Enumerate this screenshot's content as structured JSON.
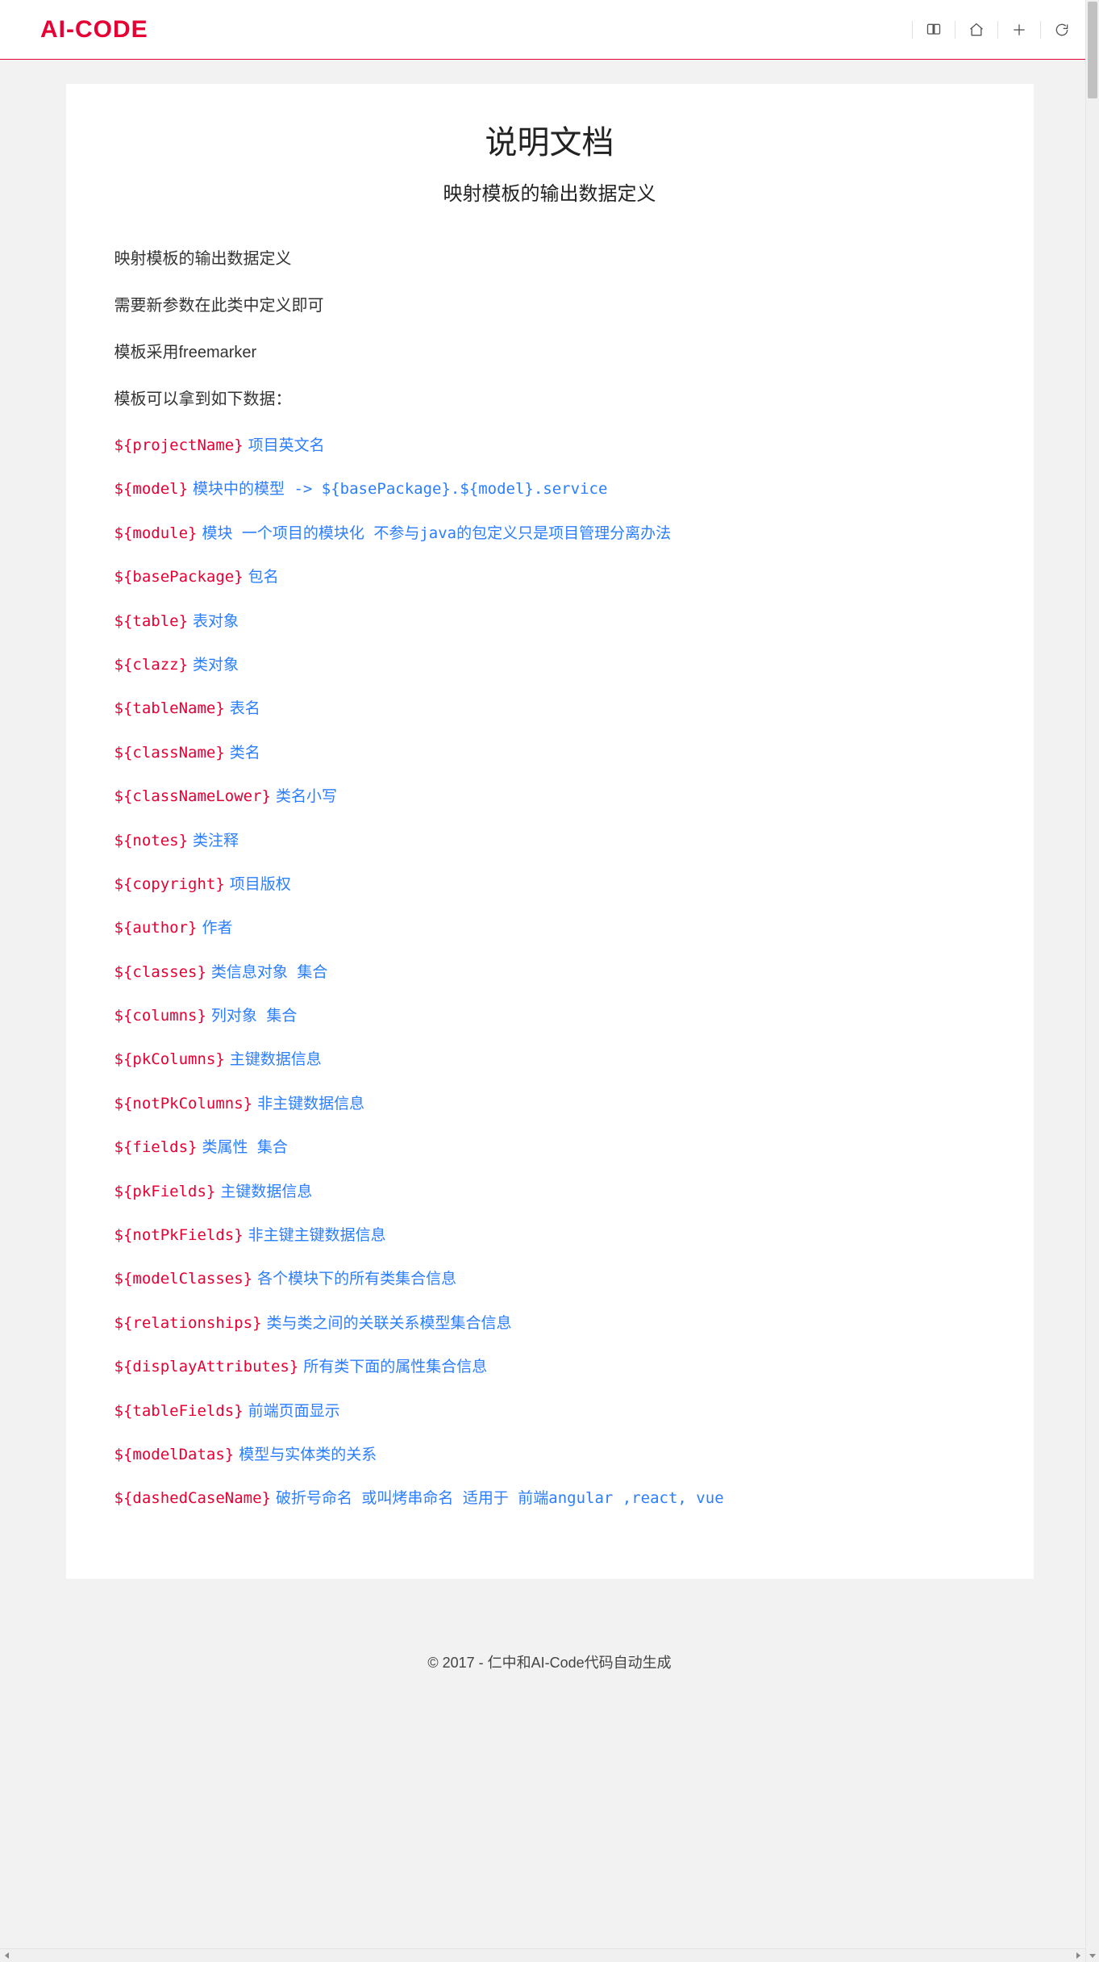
{
  "header": {
    "logo": "AI-CODE"
  },
  "doc": {
    "title": "说明文档",
    "subtitle": "映射模板的输出数据定义",
    "plainLines": [
      "映射模板的输出数据定义",
      "需要新参数在此类中定义即可",
      "模板采用freemarker",
      "模板可以拿到如下数据："
    ],
    "defs": [
      {
        "key": "${projectName}",
        "desc": "项目英文名"
      },
      {
        "key": "${model}",
        "desc": "模块中的模型 -> ${basePackage}.${model}.service"
      },
      {
        "key": "${module}",
        "desc": "模块  一个项目的模块化  不参与java的包定义只是项目管理分离办法"
      },
      {
        "key": "${basePackage}",
        "desc": "包名"
      },
      {
        "key": "${table}",
        "desc": "表对象"
      },
      {
        "key": "${clazz}",
        "desc": "类对象"
      },
      {
        "key": "${tableName}",
        "desc": "表名"
      },
      {
        "key": "${className}",
        "desc": "类名"
      },
      {
        "key": "${classNameLower}",
        "desc": "类名小写"
      },
      {
        "key": "${notes}",
        "desc": "类注释"
      },
      {
        "key": "${copyright}",
        "desc": "项目版权"
      },
      {
        "key": "${author}",
        "desc": "作者"
      },
      {
        "key": "${classes}",
        "desc": "类信息对象  集合"
      },
      {
        "key": "${columns}",
        "desc": "列对象  集合"
      },
      {
        "key": "${pkColumns}",
        "desc": "主键数据信息"
      },
      {
        "key": "${notPkColumns}",
        "desc": "非主键数据信息"
      },
      {
        "key": "${fields}",
        "desc": "类属性  集合"
      },
      {
        "key": "${pkFields}",
        "desc": "主键数据信息"
      },
      {
        "key": "${notPkFields}",
        "desc": "非主键主键数据信息"
      },
      {
        "key": "${modelClasses}",
        "desc": "各个模块下的所有类集合信息"
      },
      {
        "key": "${relationships}",
        "desc": "类与类之间的关联关系模型集合信息"
      },
      {
        "key": "${displayAttributes}",
        "desc": "所有类下面的属性集合信息"
      },
      {
        "key": "${tableFields}",
        "desc": "前端页面显示"
      },
      {
        "key": "${modelDatas}",
        "desc": "模型与实体类的关系"
      },
      {
        "key": "${dashedCaseName}",
        "desc": "破折号命名  或叫烤串命名  适用于  前端angular ,react, vue"
      }
    ]
  },
  "footer": {
    "text": "© 2017 - 仁中和AI-Code代码自动生成"
  }
}
